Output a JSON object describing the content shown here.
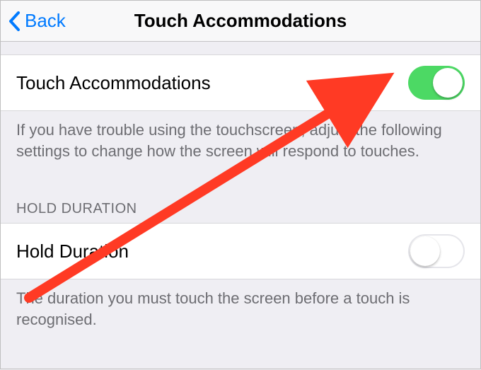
{
  "header": {
    "back_label": "Back",
    "title": "Touch Accommodations"
  },
  "section1": {
    "row_label": "Touch Accommodations",
    "toggle_on": true,
    "footer": "If you have trouble using the touchscreen, adjust the following settings to change how the screen will respond to touches."
  },
  "section2": {
    "header": "HOLD DURATION",
    "row_label": "Hold Duration",
    "toggle_on": false,
    "footer": "The duration you must touch the screen before a touch is recognised."
  },
  "annotation": {
    "arrow_color": "#ff3a24"
  }
}
